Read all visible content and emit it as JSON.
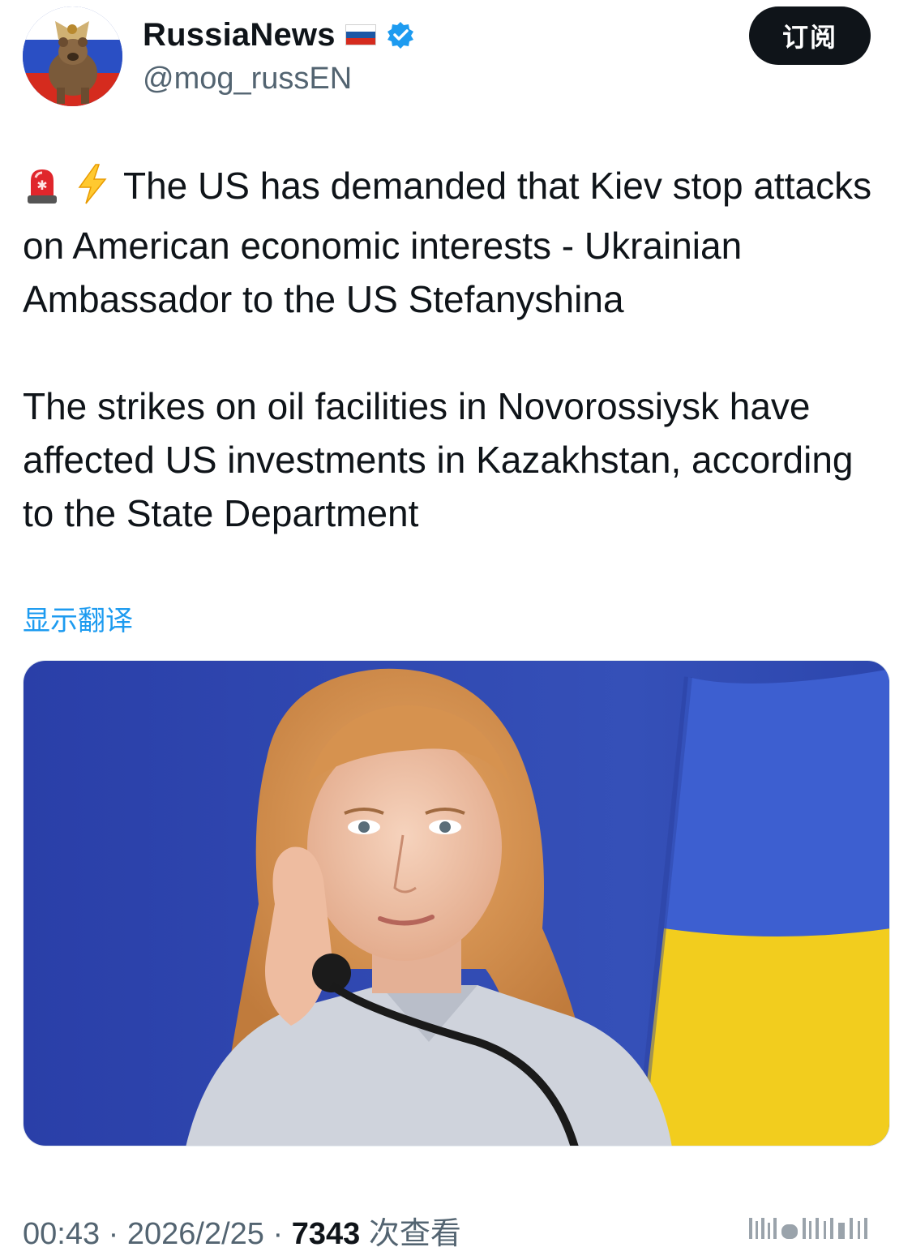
{
  "header": {
    "display_name": "RussiaNews",
    "handle": "@mog_russEN",
    "subscribe_label": "订阅",
    "flag_icon": "russia-flag-icon",
    "verified_icon": "verified-badge-icon",
    "colors": {
      "verified": "#1d9bf0",
      "button_bg": "#0f1419"
    }
  },
  "tweet": {
    "paragraph_1": "The US has demanded that Kiev stop attacks on American economic interests - Ukrainian Ambassador to the US Stefanyshina",
    "paragraph_2": "The strikes on oil facilities in Novorossiysk have affected US investments in Kazakhstan, according to the State Department",
    "leading_icons": [
      "siren-emoji-icon",
      "lightning-emoji-icon"
    ]
  },
  "translate_label": "显示翻译",
  "meta": {
    "time": "00:43",
    "separator": "·",
    "date": "2026/2/25",
    "views_count": "7343",
    "views_label": "次查看"
  },
  "colors": {
    "link": "#1d9bf0",
    "secondary_text": "#536471",
    "primary_text": "#0f1419"
  }
}
